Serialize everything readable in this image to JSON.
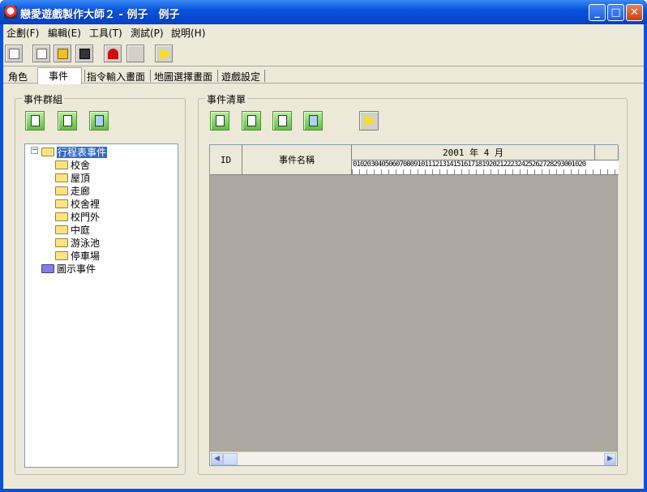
{
  "window": {
    "title": "戀愛遊戲製作大師２ - 例子　例子",
    "minimize": "_",
    "maximize": "□",
    "close": "✕"
  },
  "menu": [
    "企劃(F)",
    "編輯(E)",
    "工具(T)",
    "測試(P)",
    "說明(H)"
  ],
  "toolbar_icons": [
    "new-page-icon",
    "open-folder-icon",
    "folder-icon",
    "save-disk-icon",
    "magnet-icon",
    "blank-icon",
    "play-icon"
  ],
  "tabs": [
    "角色",
    "事件",
    "指令輸入畫面",
    "地圖選擇畫面",
    "遊戲設定"
  ],
  "active_tab": "事件",
  "event_group": {
    "label": "事件群組",
    "button_icons": [
      "new-icon",
      "edit-icon",
      "delete-icon"
    ],
    "tree": {
      "root": "行程表事件",
      "children": [
        "校舍",
        "屋頂",
        "走廊",
        "校舍裡",
        "校門外",
        "中庭",
        "游泳池",
        "停車場"
      ],
      "other": "圖示事件"
    }
  },
  "event_list": {
    "label": "事件清單",
    "button_icons": [
      "new-icon",
      "edit-icon",
      "copy-icon",
      "delete-icon",
      "play-icon"
    ],
    "columns": {
      "id": "ID",
      "name": "事件名稱",
      "month": "2001 年 4 月",
      "days": "01020304050607080910111213141516171819202122232425262728293001020"
    }
  },
  "colors": {
    "title_blue": "#0a55e0",
    "face": "#ece9d8",
    "selection": "#316ac5",
    "empty_grid": "#ada8a0"
  }
}
